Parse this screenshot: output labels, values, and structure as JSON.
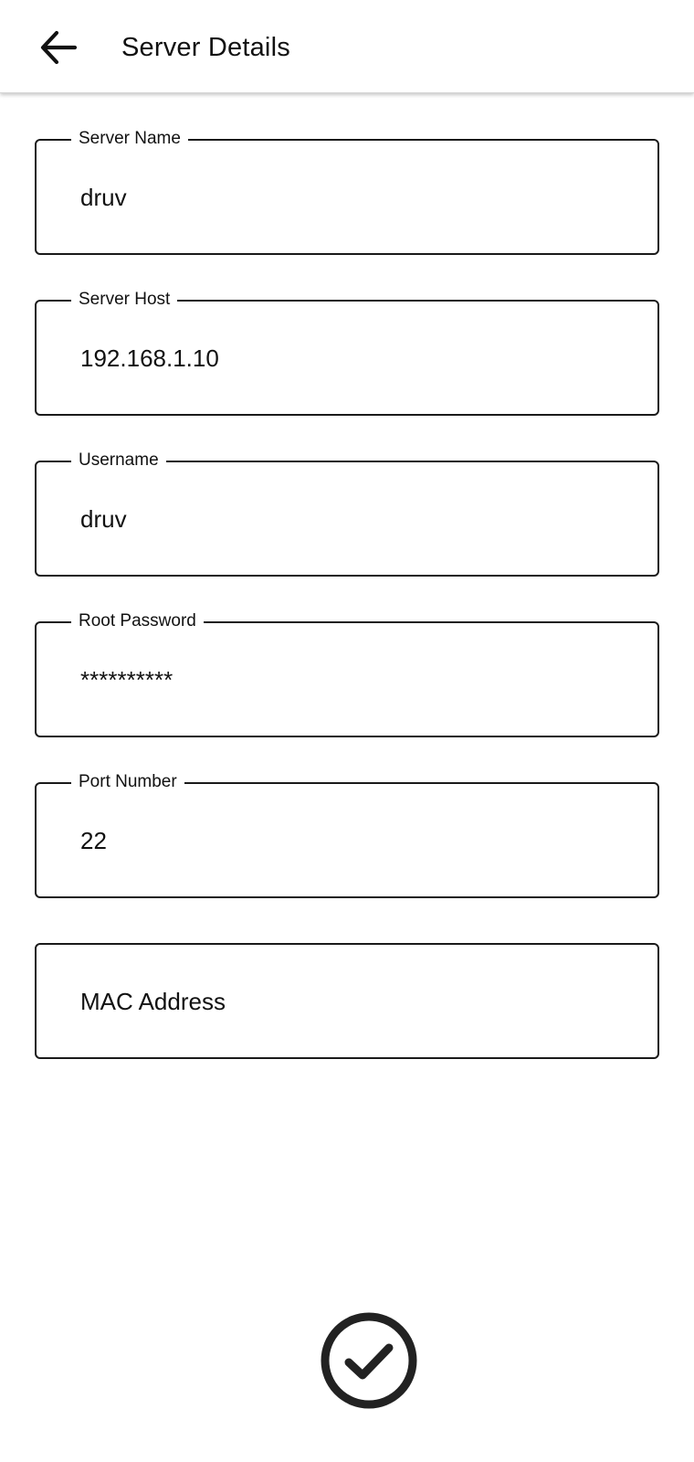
{
  "header": {
    "title": "Server Details",
    "back_icon": "arrow-left-icon"
  },
  "form": {
    "server_name": {
      "label": "Server Name",
      "value": "druv"
    },
    "server_host": {
      "label": "Server Host",
      "value": "192.168.1.10"
    },
    "username": {
      "label": "Username",
      "value": "druv"
    },
    "root_password": {
      "label": "Root Password",
      "value": "**********"
    },
    "port_number": {
      "label": "Port Number",
      "value": "22"
    },
    "mac_address": {
      "placeholder": "MAC Address",
      "value": ""
    }
  },
  "submit": {
    "icon": "check-circle-icon"
  }
}
